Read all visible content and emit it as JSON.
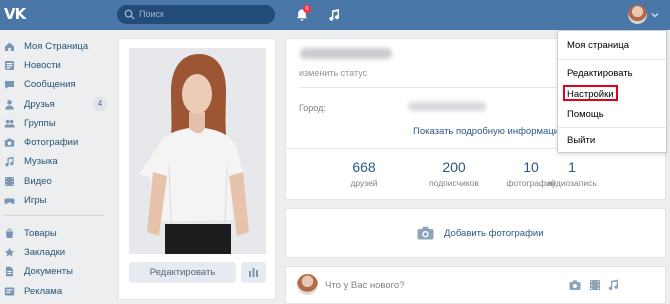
{
  "header": {
    "logo": "VK",
    "search_placeholder": "Поиск",
    "notifications_count": "6",
    "accent_color": "#4a76a8"
  },
  "left_menu": {
    "items": [
      {
        "label": "Моя Страница",
        "icon": "home-icon"
      },
      {
        "label": "Новости",
        "icon": "news-icon"
      },
      {
        "label": "Сообщения",
        "icon": "messages-icon"
      },
      {
        "label": "Друзья",
        "icon": "friends-icon",
        "count": "4"
      },
      {
        "label": "Группы",
        "icon": "groups-icon"
      },
      {
        "label": "Фотографии",
        "icon": "camera-icon"
      },
      {
        "label": "Музыка",
        "icon": "music-icon"
      },
      {
        "label": "Видео",
        "icon": "video-icon"
      },
      {
        "label": "Игры",
        "icon": "games-icon"
      },
      {
        "label": "Товары",
        "icon": "goods-icon"
      },
      {
        "label": "Закладки",
        "icon": "bookmarks-icon"
      },
      {
        "label": "Документы",
        "icon": "documents-icon"
      },
      {
        "label": "Реклама",
        "icon": "ads-icon"
      }
    ]
  },
  "profile_photo": {
    "edit_label": "Редактировать"
  },
  "profile": {
    "status_placeholder": "изменить статус",
    "city_label": "Город:",
    "show_more": "Показать подробную информацию",
    "counters": [
      {
        "value": "668",
        "label": "друзей"
      },
      {
        "value": "200",
        "label": "подписчиков"
      },
      {
        "value": "10",
        "label": "фотографий"
      },
      {
        "value": "1",
        "label": "аудиозапись"
      }
    ]
  },
  "add_photos": {
    "label": "Добавить фотографии"
  },
  "post": {
    "placeholder": "Что у Вас нового?"
  },
  "dropdown": {
    "items": [
      {
        "label": "Моя страница"
      },
      {
        "label": "Редактировать"
      },
      {
        "label": "Настройки",
        "highlighted": true
      },
      {
        "label": "Помощь"
      },
      {
        "label": "Выйти"
      }
    ]
  }
}
